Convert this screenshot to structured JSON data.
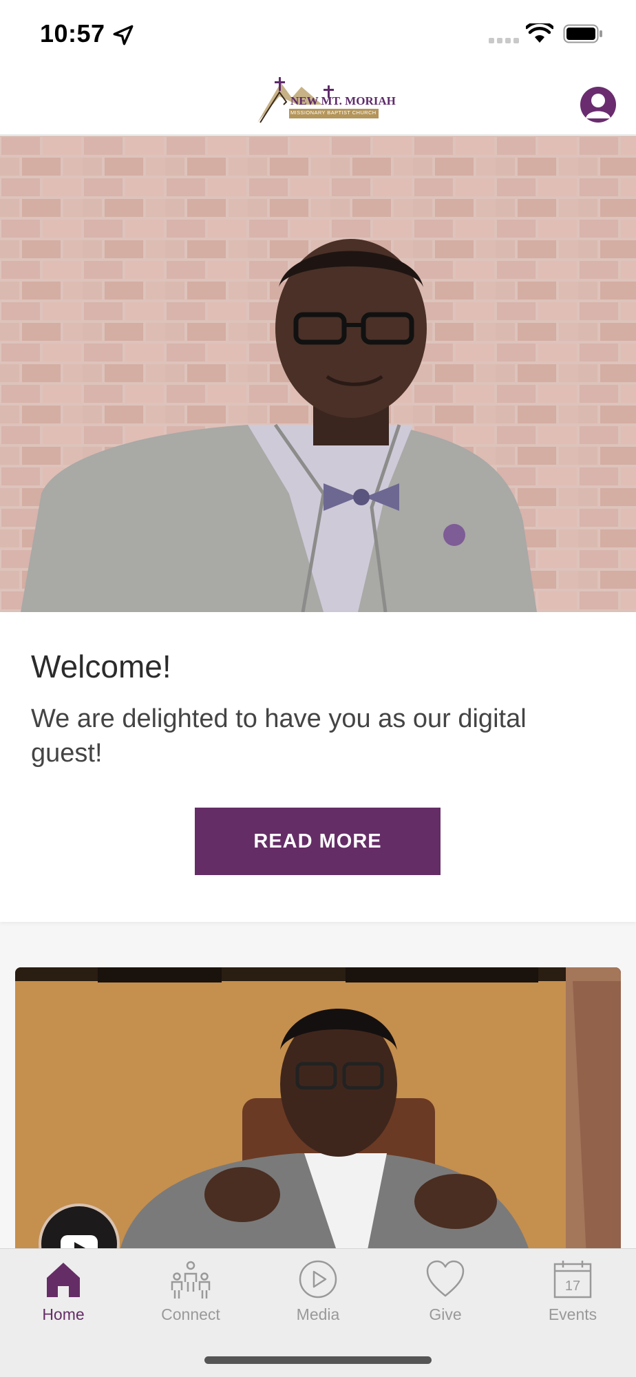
{
  "status_bar": {
    "time": "10:57"
  },
  "header": {
    "logo_line1": "NEW MT. MORIAH",
    "logo_line2": "MISSIONARY BAPTIST CHURCH"
  },
  "welcome": {
    "title": "Welcome!",
    "body": "We are delighted to have you as our digital guest!",
    "button": "READ MORE"
  },
  "tabs": [
    {
      "label": "Home",
      "icon": "home-icon",
      "active": true
    },
    {
      "label": "Connect",
      "icon": "people-icon",
      "active": false
    },
    {
      "label": "Media",
      "icon": "play-circle-icon",
      "active": false
    },
    {
      "label": "Give",
      "icon": "heart-icon",
      "active": false
    },
    {
      "label": "Events",
      "icon": "calendar-icon",
      "active": false,
      "calendar_day": "17"
    }
  ],
  "colors": {
    "accent": "#652d66",
    "tab_inactive": "#999999"
  }
}
